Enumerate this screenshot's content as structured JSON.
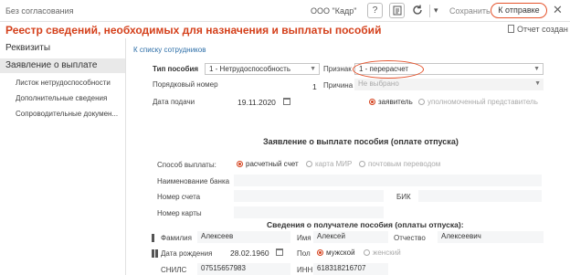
{
  "topbar": {
    "status": "Без согласования",
    "company": "ООО \"Кадр\"",
    "help_icon": "?",
    "save_label": "Сохранить",
    "submit_label": "К отправке",
    "close_icon": "✕"
  },
  "header": {
    "title": "Реестр сведений, необходимых для назначения и выплаты пособий",
    "report_label": "Отчет создан"
  },
  "sidebar": {
    "items": [
      {
        "label": "Реквизиты"
      },
      {
        "label": "Заявление о выплате"
      }
    ],
    "subitems": [
      {
        "label": "Листок нетрудоспособности"
      },
      {
        "label": "Дополнительные сведения"
      },
      {
        "label": "Сопроводительные докумен..."
      }
    ]
  },
  "main": {
    "back_link": "К списку сотрудников",
    "benefit_type_label": "Тип пособия",
    "benefit_type_value": "1 - Нетрудоспособность",
    "sign_label": "Признак",
    "sign_value": "1 - перерасчет",
    "order_label": "Порядковый номер",
    "order_value": "1",
    "reason_label": "Причина",
    "reason_placeholder": "Не выбрано",
    "submit_date_label": "Дата подачи",
    "submit_date_value": "19.11.2020",
    "applicant_options": [
      "заявитель",
      "уполномоченный представитель"
    ],
    "section_title": "Заявление о выплате пособия (оплате отпуска)",
    "payment_method_label": "Способ выплаты:",
    "payment_options": [
      "расчетный счет",
      "карта МИР",
      "почтовым переводом"
    ],
    "bank_name_label": "Наименование банка",
    "account_label": "Номер счета",
    "bik_label": "БИК",
    "card_label": "Номер карты",
    "recipient_title": "Сведения о получателе пособия (оплаты отпуска):",
    "surname_label": "Фамилия",
    "surname_value": "Алексеев",
    "name_label": "Имя",
    "name_value": "Алексей",
    "patronymic_label": "Отчество",
    "patronymic_value": "Алексеевич",
    "birth_label": "Дата рождения",
    "birth_value": "28.02.1960",
    "gender_label": "Пол",
    "gender_options": [
      "мужской",
      "женский"
    ],
    "snils_label": "СНИЛС",
    "snils_value": "07515657983",
    "inn_label": "ИНН",
    "inn_value": "618318216707"
  }
}
